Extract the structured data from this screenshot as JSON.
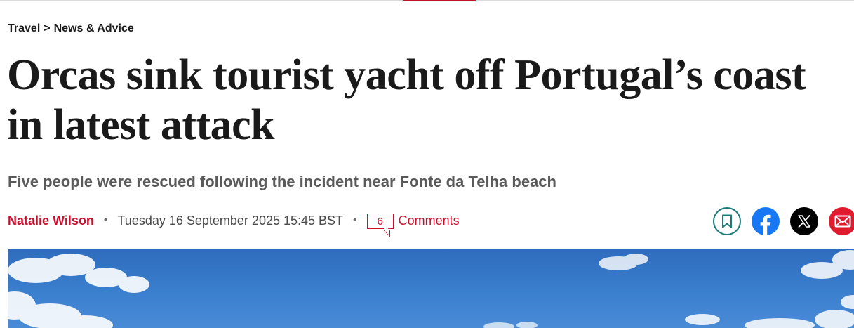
{
  "breadcrumb": {
    "section": "Travel",
    "separator": ">",
    "subsection": "News & Advice"
  },
  "article": {
    "headline": "Orcas sink tourist yacht off Portugal’s coast in latest attack",
    "standfirst": "Five people were rescued following the incident near Fonte da Telha beach",
    "author": "Natalie Wilson",
    "separator": "•",
    "published": "Tuesday 16 September 2025 15:45 BST",
    "comment_count": "6",
    "comments_label": "Comments"
  },
  "share": {
    "icons": [
      "bookmark-icon",
      "facebook-icon",
      "x-icon",
      "email-icon"
    ]
  },
  "colors": {
    "accent": "#c8102e",
    "bookmark": "#1a7b7a",
    "facebook": "#1877f2",
    "x": "#000000",
    "email": "#e01b2f",
    "sky": "#3b7fcf"
  }
}
